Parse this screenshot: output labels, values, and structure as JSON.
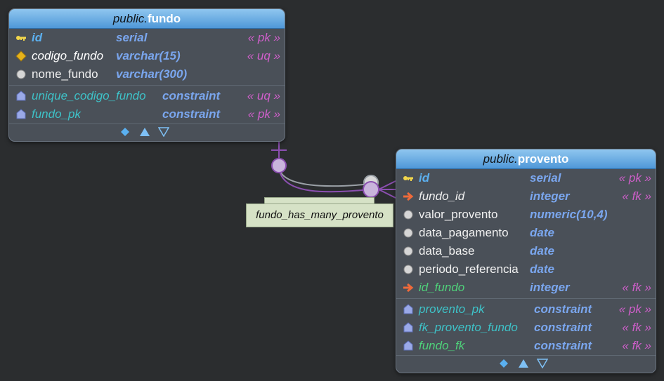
{
  "tables": {
    "fundo": {
      "schema": "public.",
      "name": "fundo",
      "columns": [
        {
          "name": "id",
          "type": "serial",
          "tag": "« pk »"
        },
        {
          "name": "codigo_fundo",
          "type": "varchar(15)",
          "tag": "« uq »"
        },
        {
          "name": "nome_fundo",
          "type": "varchar(300)",
          "tag": ""
        }
      ],
      "constraints": [
        {
          "name": "unique_codigo_fundo",
          "type": "constraint",
          "tag": "« uq »"
        },
        {
          "name": "fundo_pk",
          "type": "constraint",
          "tag": "« pk »"
        }
      ]
    },
    "provento": {
      "schema": "public.",
      "name": "provento",
      "columns": [
        {
          "name": "id",
          "type": "serial",
          "tag": "« pk »"
        },
        {
          "name": "fundo_id",
          "type": "integer",
          "tag": "« fk »"
        },
        {
          "name": "valor_provento",
          "type": "numeric(10,4)",
          "tag": ""
        },
        {
          "name": "data_pagamento",
          "type": "date",
          "tag": ""
        },
        {
          "name": "data_base",
          "type": "date",
          "tag": ""
        },
        {
          "name": "periodo_referencia",
          "type": "date",
          "tag": ""
        },
        {
          "name": "id_fundo",
          "type": "integer",
          "tag": "« fk »"
        }
      ],
      "constraints": [
        {
          "name": "provento_pk",
          "type": "constraint",
          "tag": "« pk »"
        },
        {
          "name": "fk_provento_fundo",
          "type": "constraint",
          "tag": "« fk »"
        },
        {
          "name": "fundo_fk",
          "type": "constraint",
          "tag": "« fk »"
        }
      ]
    }
  },
  "relationship": {
    "label": "fundo_has_many_provento"
  },
  "colors": {
    "background": "#2b2d2f",
    "table_body": "#4a5058",
    "header": "#4f98d8",
    "type": "#7aa6ee",
    "tag": "#d05fcb",
    "connector": "#8b4fb0"
  }
}
